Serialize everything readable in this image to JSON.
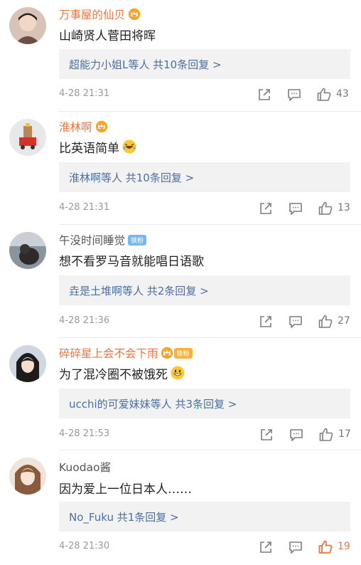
{
  "comments": [
    {
      "name": "万事屋的仙贝",
      "text": "山崎贤人菅田将晖",
      "reply": "超能力小姐L等人 共10条回复 >",
      "time": "4-28 21:31",
      "likes": "43"
    },
    {
      "name": "淮林啊",
      "text": "比英语简单",
      "reply": "淮林啊等人 共10条回复 >",
      "time": "4-28 21:31",
      "likes": "13"
    },
    {
      "name": "午没时间睡觉",
      "badge": "铁粉",
      "text": "想不看罗马音就能唱日语歌",
      "reply": "垚是土堆啊等人 共2条回复 >",
      "time": "4-28 21:36",
      "likes": "27"
    },
    {
      "name": "碎碎星上会不会下雨",
      "badge": "铁粉",
      "text": "为了混冷圈不被饿死",
      "reply": "ucchi的可爱妹妹等人 共3条回复 >",
      "time": "4-28 21:53",
      "likes": "17"
    },
    {
      "name": "Kuodao酱",
      "text": "因为爱上一位日本人……",
      "reply": "No_Fuku 共1条回复 >",
      "time": "4-28 21:30",
      "likes": "19"
    }
  ],
  "icons": {
    "share": "share-icon",
    "comment": "comment-icon",
    "like": "thumbs-up-icon",
    "crown": "fan-crown-icon"
  },
  "colors": {
    "name_accent": "#e8743c",
    "reply_link": "#4a6fa0",
    "reply_bg": "#f2f2f2",
    "liked": "#e8743c"
  }
}
